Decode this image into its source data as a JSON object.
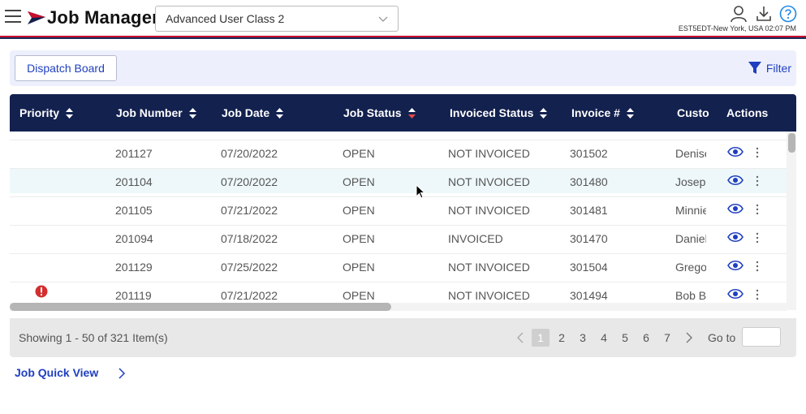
{
  "header": {
    "app_title": "Job Manager",
    "class_select_value": "Advanced User Class 2",
    "timezone": "EST5EDT-New York, USA 02:07 PM"
  },
  "toolbar": {
    "dispatch_label": "Dispatch Board",
    "filter_label": "Filter"
  },
  "table": {
    "columns": [
      {
        "key": "priority",
        "label": "Priority",
        "sort": "none"
      },
      {
        "key": "job_number",
        "label": "Job Number",
        "sort": "none"
      },
      {
        "key": "job_date",
        "label": "Job Date",
        "sort": "none"
      },
      {
        "key": "job_status",
        "label": "Job Status",
        "sort": "descending"
      },
      {
        "key": "invoiced_status",
        "label": "Invoiced Status",
        "sort": "none"
      },
      {
        "key": "invoice_no",
        "label": "Invoice #",
        "sort": "none"
      },
      {
        "key": "customer",
        "label": "Custo",
        "sort": "none"
      },
      {
        "key": "actions",
        "label": "Actions",
        "sort": "none"
      }
    ],
    "rows": [
      {
        "priority_alert": false,
        "job_number": "201127",
        "job_date": "07/20/2022",
        "job_status": "OPEN",
        "invoiced_status": "NOT INVOICED",
        "invoice_no": "301502",
        "customer": "Denise"
      },
      {
        "priority_alert": false,
        "job_number": "201104",
        "job_date": "07/20/2022",
        "job_status": "OPEN",
        "invoiced_status": "NOT INVOICED",
        "invoice_no": "301480",
        "customer": "Joseph"
      },
      {
        "priority_alert": false,
        "job_number": "201105",
        "job_date": "07/21/2022",
        "job_status": "OPEN",
        "invoiced_status": "NOT INVOICED",
        "invoice_no": "301481",
        "customer": "Minnie"
      },
      {
        "priority_alert": false,
        "job_number": "201094",
        "job_date": "07/18/2022",
        "job_status": "OPEN",
        "invoiced_status": "INVOICED",
        "invoice_no": "301470",
        "customer": "Daniel"
      },
      {
        "priority_alert": false,
        "job_number": "201129",
        "job_date": "07/25/2022",
        "job_status": "OPEN",
        "invoiced_status": "NOT INVOICED",
        "invoice_no": "301504",
        "customer": "Grego"
      },
      {
        "priority_alert": true,
        "job_number": "201119",
        "job_date": "07/21/2022",
        "job_status": "OPEN",
        "invoiced_status": "NOT INVOICED",
        "invoice_no": "301494",
        "customer": "Bob B"
      }
    ]
  },
  "pager": {
    "summary": "Showing 1 - 50 of 321 Item(s)",
    "pages": [
      "1",
      "2",
      "3",
      "4",
      "5",
      "6",
      "7"
    ],
    "current_page": "1",
    "goto_label": "Go to",
    "goto_value": ""
  },
  "quick_view": {
    "label": "Job Quick View"
  },
  "icons": {
    "menu": "hamburger-menu-icon",
    "logo": "paper-plane-logo-icon",
    "user": "user-icon",
    "download": "download-icon",
    "help": "help-icon",
    "filter": "filter-funnel-icon",
    "view": "eye-icon",
    "more": "kebab-menu-icon",
    "priority": "alert-circle-icon"
  },
  "colors": {
    "navy": "#13214f",
    "accent_blue": "#1f3fbf",
    "help_blue": "#1e88e5",
    "alert_red": "#d32f2f",
    "stripe_red": "#c8102e",
    "sort_active": "#e64a4a",
    "toolbar_bg": "#edf0fc",
    "row_hover": "#eef8fa"
  }
}
